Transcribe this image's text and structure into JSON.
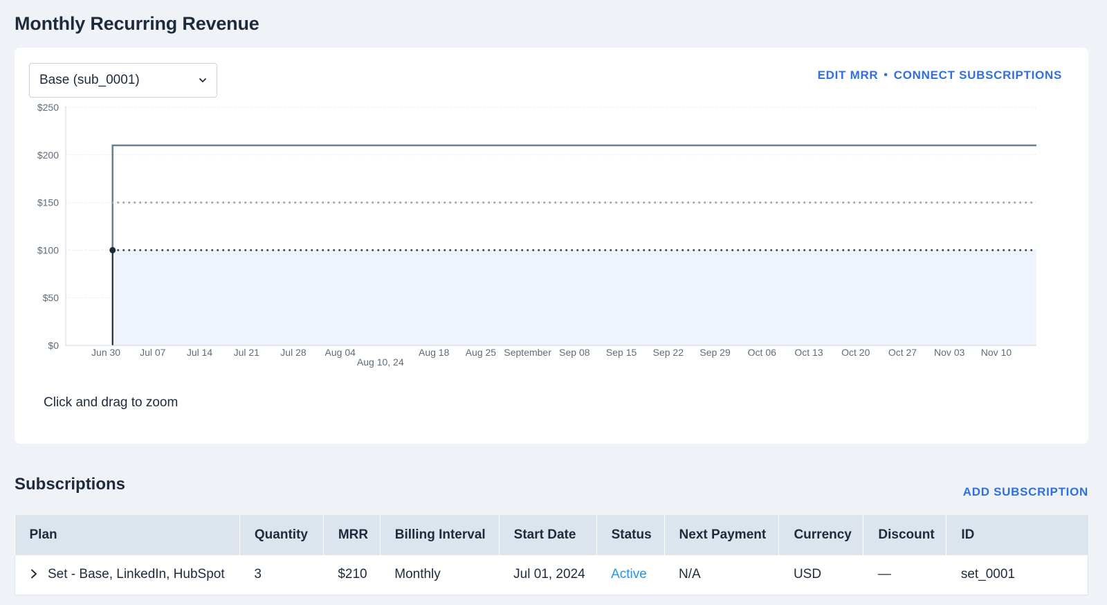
{
  "page": {
    "title": "Monthly Recurring Revenue"
  },
  "chart_panel": {
    "selector": {
      "value": "Base (sub_0001)"
    },
    "actions": {
      "edit_mrr": "EDIT MRR",
      "separator": "•",
      "connect": "CONNECT SUBSCRIPTIONS"
    },
    "zoom_hint": "Click and drag to zoom"
  },
  "chart_data": {
    "type": "line",
    "title": "",
    "xlabel": "",
    "ylabel": "",
    "ylim": [
      0,
      250
    ],
    "y_ticks": [
      "$0",
      "$50",
      "$100",
      "$150",
      "$200",
      "$250"
    ],
    "y_tick_values": [
      0,
      50,
      100,
      150,
      200,
      250
    ],
    "x_ticks": [
      {
        "label": "Jun 30",
        "date": "2024-06-30"
      },
      {
        "label": "Jul 07",
        "date": "2024-07-07"
      },
      {
        "label": "Jul 14",
        "date": "2024-07-14"
      },
      {
        "label": "Jul 21",
        "date": "2024-07-21"
      },
      {
        "label": "Jul 28",
        "date": "2024-07-28"
      },
      {
        "label": "Aug 04",
        "date": "2024-08-04"
      },
      {
        "label": "Aug 10, 24",
        "date": "2024-08-10",
        "row": 2
      },
      {
        "label": "Aug 18",
        "date": "2024-08-18"
      },
      {
        "label": "Aug 25",
        "date": "2024-08-25"
      },
      {
        "label": "September",
        "date": "2024-09-01"
      },
      {
        "label": "Sep 08",
        "date": "2024-09-08"
      },
      {
        "label": "Sep 15",
        "date": "2024-09-15"
      },
      {
        "label": "Sep 22",
        "date": "2024-09-22"
      },
      {
        "label": "Sep 29",
        "date": "2024-09-29"
      },
      {
        "label": "Oct 06",
        "date": "2024-10-06"
      },
      {
        "label": "Oct 13",
        "date": "2024-10-13"
      },
      {
        "label": "Oct 20",
        "date": "2024-10-20"
      },
      {
        "label": "Oct 27",
        "date": "2024-10-27"
      },
      {
        "label": "Nov 03",
        "date": "2024-11-03"
      },
      {
        "label": "Nov 10",
        "date": "2024-11-10"
      }
    ],
    "x_range": [
      "2024-06-24",
      "2024-11-16"
    ],
    "grid": true,
    "series": [
      {
        "style": "area",
        "color": "#1b2a3d",
        "fill": "#eef3fc",
        "points": [
          {
            "x": "2024-07-01",
            "y": 0
          },
          {
            "x": "2024-07-01",
            "y": 100
          },
          {
            "x": "2024-11-16",
            "y": 100
          }
        ]
      },
      {
        "style": "step",
        "color": "#6c7f8f",
        "points": [
          {
            "x": "2024-07-01",
            "y": 100
          },
          {
            "x": "2024-07-01",
            "y": 210
          },
          {
            "x": "2024-11-16",
            "y": 210
          }
        ]
      },
      {
        "style": "dotted",
        "color": "#3c4a5a",
        "points": [
          {
            "x": "2024-07-01",
            "y": 100
          },
          {
            "x": "2024-11-16",
            "y": 100
          }
        ]
      },
      {
        "style": "dotted",
        "color": "#9aa6b2",
        "points": [
          {
            "x": "2024-07-01",
            "y": 150
          },
          {
            "x": "2024-11-16",
            "y": 150
          }
        ]
      }
    ],
    "markers": [
      {
        "x": "2024-07-01",
        "y": 100,
        "color": "#1b2a3d"
      }
    ]
  },
  "subscriptions": {
    "title": "Subscriptions",
    "add_label": "ADD SUBSCRIPTION",
    "columns": [
      "Plan",
      "Quantity",
      "MRR",
      "Billing Interval",
      "Start Date",
      "Status",
      "Next Payment",
      "Currency",
      "Discount",
      "ID"
    ],
    "rows": [
      {
        "plan": "Set - Base, LinkedIn, HubSpot",
        "quantity": "3",
        "mrr": "$210",
        "billing_interval": "Monthly",
        "start_date": "Jul 01, 2024",
        "status": "Active",
        "next_payment": "N/A",
        "currency": "USD",
        "discount": "—",
        "id": "set_0001"
      }
    ],
    "status_color": "#2196e8"
  }
}
